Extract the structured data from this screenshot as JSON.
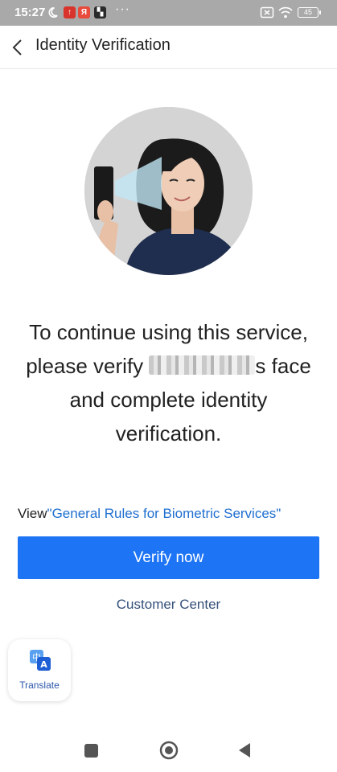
{
  "status_bar": {
    "time": "15:27",
    "badges": [
      "↑",
      "Я",
      "▚"
    ],
    "more": "···",
    "battery": "45"
  },
  "header": {
    "back_icon": "chevron-left-icon",
    "title": "Identity Verification"
  },
  "message": {
    "line1": "To continue using this service,",
    "line2_prefix": "please verify ",
    "line2_suffix": "s face",
    "line3": "and complete identity",
    "line4": "verification."
  },
  "rules": {
    "prefix": "View",
    "link": "\"General Rules for Biometric Services\""
  },
  "verify_button": "Verify now",
  "customer_center": "Customer Center",
  "translate": {
    "icon": "translate-icon",
    "label": "Translate"
  },
  "colors": {
    "primary": "#1d74f5",
    "link": "#1f6fd0",
    "status_bar": "#a9a9a9"
  }
}
